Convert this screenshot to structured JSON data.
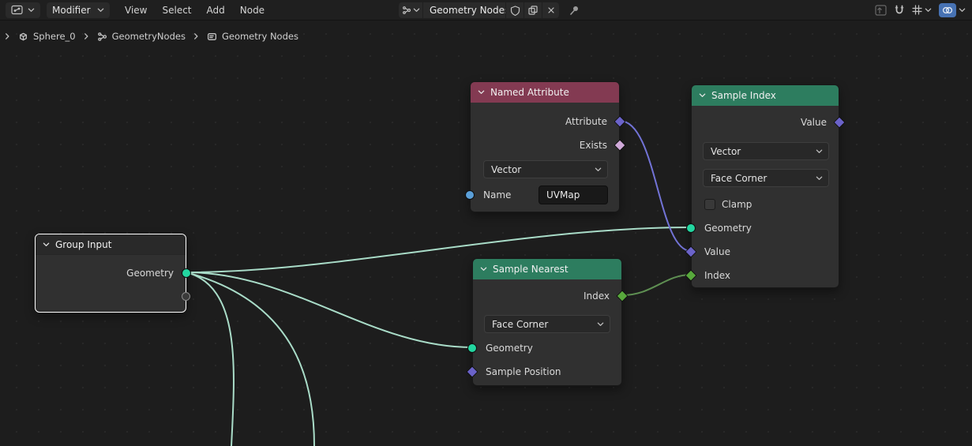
{
  "colors": {
    "accent_blue": "#4772b3",
    "header_attribute": "#833a52",
    "header_geometry": "#2d7d5f",
    "node_header_plain": "#292929",
    "socket_geometry": "#23d6a0",
    "socket_vector": "#6b63c9",
    "socket_boolean": "#cfa9d8",
    "socket_integer": "#58a83c",
    "socket_string": "#5b9fd8",
    "wire_geometry": "#a9dcc8",
    "wire_vector": "#7273d6",
    "wire_integer": "#5e8f52",
    "selected_border": "#ffffff"
  },
  "topbar": {
    "mode": "Modifier",
    "menus": [
      "View",
      "Select",
      "Add",
      "Node"
    ],
    "datablock_name": "Geometry Nodes"
  },
  "breadcrumb": {
    "object": "Sphere_0",
    "modifier": "GeometryNodes",
    "node_tree": "Geometry Nodes"
  },
  "nodes": {
    "named_attribute": {
      "title": "Named Attribute",
      "output_attribute": "Attribute",
      "output_exists": "Exists",
      "data_type": "Vector",
      "name_label": "Name",
      "name_value": "UVMap"
    },
    "sample_index": {
      "title": "Sample Index",
      "output_value": "Value",
      "data_type": "Vector",
      "domain": "Face Corner",
      "clamp_label": "Clamp",
      "clamp_checked": false,
      "input_geometry": "Geometry",
      "input_value": "Value",
      "input_index": "Index"
    },
    "sample_nearest": {
      "title": "Sample Nearest",
      "output_index": "Index",
      "domain": "Face Corner",
      "input_geometry": "Geometry",
      "input_sample_position": "Sample Position"
    },
    "group_input": {
      "title": "Group Input",
      "output_geometry": "Geometry"
    }
  }
}
